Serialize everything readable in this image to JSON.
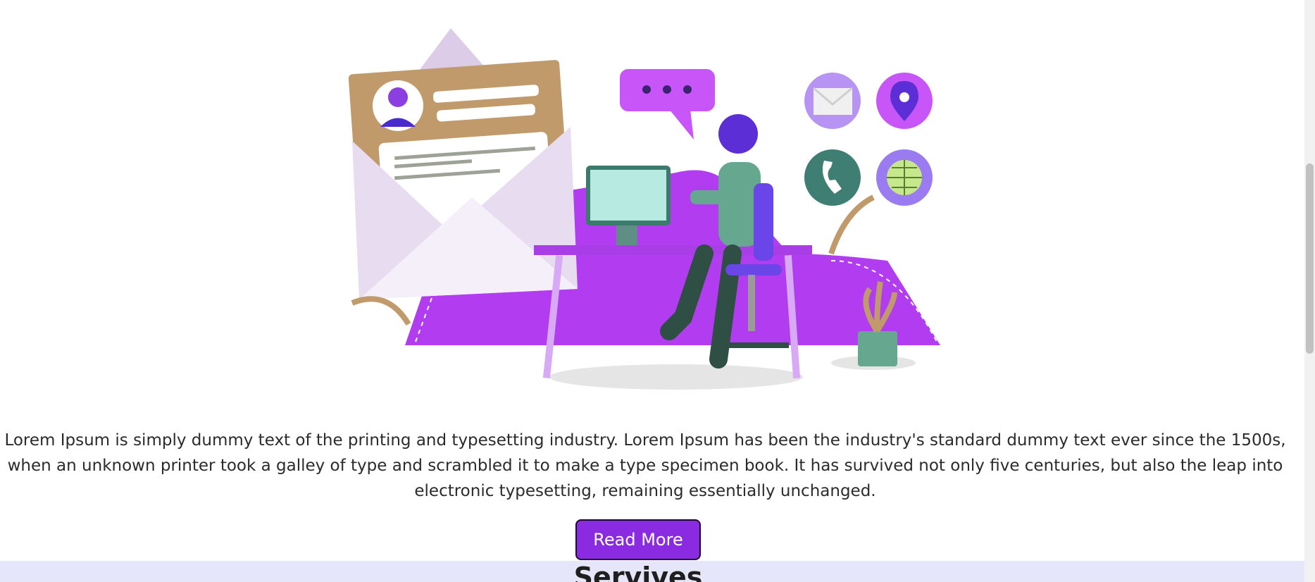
{
  "hero": {
    "illustration_icon": "contact-support-illustration",
    "contact_icons": [
      "mail-icon",
      "location-pin-icon",
      "phone-icon",
      "globe-icon"
    ]
  },
  "intro": {
    "text": "Lorem Ipsum is simply dummy text of the printing and typesetting industry. Lorem Ipsum has been the industry's standard dummy text ever since the 1500s, when an unknown printer took a galley of type and scrambled it to make a type specimen book. It has survived not only five centuries, but also the leap into electronic typesetting, remaining essentially unchanged."
  },
  "cta": {
    "read_more_label": "Read More"
  },
  "services": {
    "title": "Servives"
  },
  "colors": {
    "accent": "#8a2be2",
    "band": "#e6e6fa",
    "purple_art": "#b13cf0"
  }
}
